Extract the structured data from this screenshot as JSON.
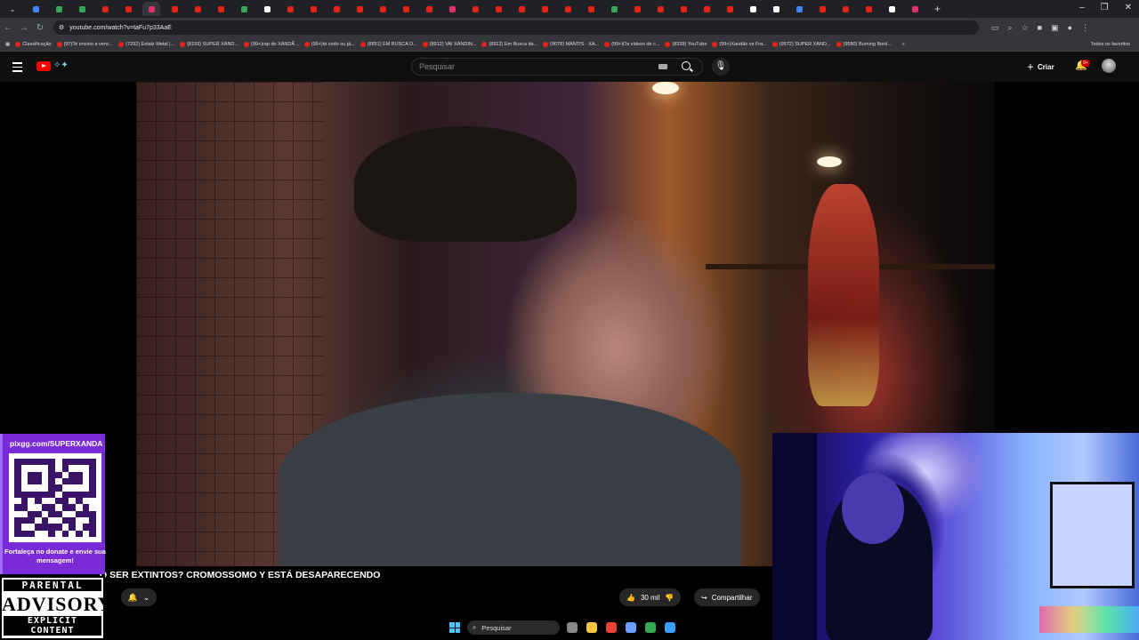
{
  "browser": {
    "url": "youtube.com/watch?v=taFu7p33AaE",
    "tab_icon_colors": [
      "#4285f4",
      "#34a853",
      "#34a853",
      "#e62117",
      "#e62117",
      "#e1306c",
      "#e62117",
      "#e62117",
      "#e62117",
      "#34a853",
      "#ffffff",
      "#e62117",
      "#e62117",
      "#e62117",
      "#e62117",
      "#e62117",
      "#e62117",
      "#e62117",
      "#e1306c",
      "#e62117",
      "#e62117",
      "#e62117",
      "#e62117",
      "#e62117",
      "#e62117",
      "#34a853",
      "#e62117",
      "#e62117",
      "#e62117",
      "#e62117",
      "#e62117",
      "#ffffff",
      "#ffffff",
      "#4285f4",
      "#e62117",
      "#e62117",
      "#e62117",
      "#ffffff",
      "#e1306c"
    ],
    "new_tab_glyph": "+",
    "bookmarks": [
      "Classificação",
      "(97)Te ensino a venc...",
      "(7292) Enlaiz Metal |...",
      "(8159) SUPER XAND...",
      "(99+)rap do XANDÃ...",
      "(99+)tá cedo ou já...",
      "(8851) EM BUSCA D...",
      "(8912) VAI XANDIN...",
      "(8912) Em Busca da...",
      "(9078) MANTIS - XA...",
      "(99+)Os vídeos de c...",
      "(8338) YouTube",
      "(99+)Xandão vs Fra...",
      "(9572) SUPER XAND...",
      "(9580) Burning Bord..."
    ],
    "bookmarks_more": "»",
    "all_bookmarks": "Todos os favoritos"
  },
  "youtube": {
    "search_placeholder": "Pesquisar",
    "create_label": "Criar",
    "notifications_badge": "9+",
    "video_title": "O SER EXTINTOS? CROMOSSOMO Y ESTÁ DESAPARECENDO",
    "like_count": "30 mil",
    "share_label": "Compartilhar"
  },
  "overlay": {
    "donate_url": "pixgg.com/SUPERXANDA",
    "donate_caption": "Fortaleça no donate e envie sua mensagem!",
    "advisory_top": "PARENTAL",
    "advisory_mid": "ADVISORY",
    "advisory_bottom": "EXPLICIT CONTENT"
  },
  "taskbar": {
    "search_label": "Pesquisar",
    "app_colors": [
      "#888888",
      "#f5c542",
      "#ea4335",
      "#6aa0ff",
      "#34a853",
      "#3aa0ff"
    ]
  }
}
